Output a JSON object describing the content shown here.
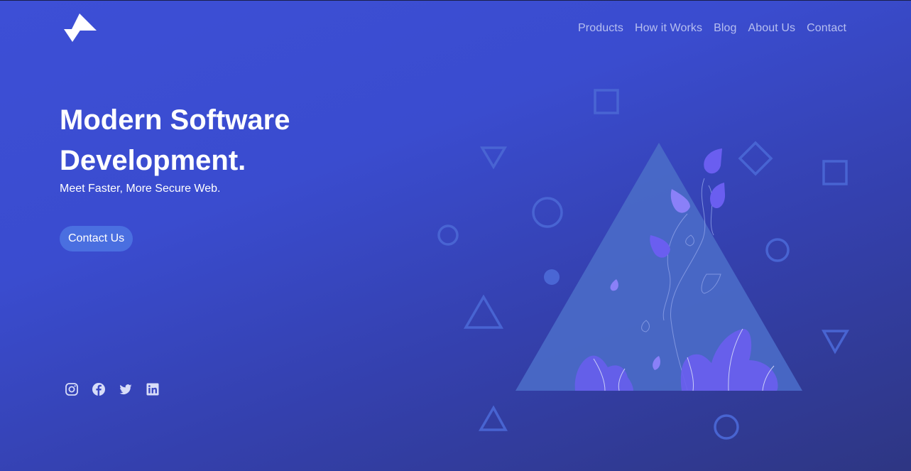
{
  "brand": {
    "logo_icon": "triangle-logo-icon"
  },
  "nav": {
    "items": [
      {
        "label": "Products"
      },
      {
        "label": "How it Works"
      },
      {
        "label": "Blog"
      },
      {
        "label": "About Us"
      },
      {
        "label": "Contact"
      }
    ]
  },
  "hero": {
    "title": "Modern Software Development.",
    "subtitle": "Meet Faster, More Secure Web.",
    "cta_label": "Contact Us"
  },
  "social": {
    "icons": [
      "instagram-icon",
      "facebook-icon",
      "twitter-icon",
      "linkedin-icon"
    ]
  },
  "colors": {
    "accent": "#4a6fe0",
    "background_start": "#3d4fd6",
    "background_end": "#2e3683",
    "nav_text": "#b7bff0",
    "leaf": "#6a5ef0"
  }
}
